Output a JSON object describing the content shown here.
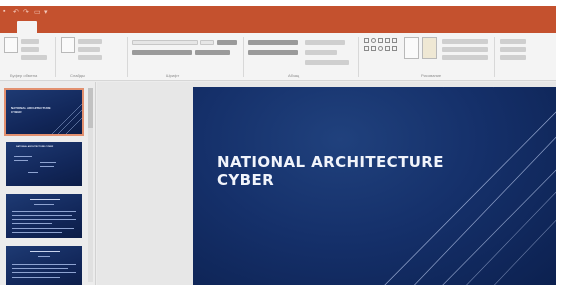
{
  "presentation": {
    "slides": [
      {
        "title": "NATIONAL ARCHITECTURE CYBER",
        "selected": true
      },
      {
        "title": "NATIONAL ARCHITECTURE CYBER",
        "selected": false
      },
      {
        "title": "",
        "selected": false
      },
      {
        "title": "",
        "selected": false
      }
    ],
    "current_slide_title": "NATIONAL ARCHITECTURE CYBER"
  },
  "ribbon": {
    "group_labels": [
      "Буфер обмена",
      "Слайды",
      "Шрифт",
      "Абзац",
      "Рисование"
    ]
  },
  "colors": {
    "title_bar": "#c4512e",
    "ribbon": "#f4f4f4",
    "slide_background": "#15306a",
    "slide_text": "#f1f4fb"
  }
}
